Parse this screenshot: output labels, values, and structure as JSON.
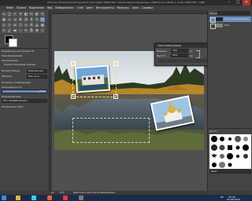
{
  "titlebar": {
    "title": "[Snimok_ekrana] (импортировано)-16.0 (Цвет RGB 8 бит гамма-корректированные, GIMP built-in sRGB, 1 слой) 1366x768 – GIMP",
    "minimize": "–",
    "maximize": "□",
    "close": "✕"
  },
  "menubar": [
    "Файл",
    "Правка",
    "Выделение",
    "Вид",
    "Изображение",
    "Слой",
    "Цвет",
    "Инструменты",
    "Фильтры",
    "Окна",
    "Справка"
  ],
  "tool_options": {
    "title": "Параметры инструментов",
    "transform_label": "Преобразование:",
    "direction_label": "Направление",
    "direction_value": "Корректирующее (назад)",
    "interpolation_label": "Интерполяция",
    "interpolation_value": "Кубическая",
    "clipping_label": "Обрезка",
    "clipping_value": "Как есть",
    "preview_label": "Показать изображение",
    "opacity_label": "Непрозрачность",
    "opacity_value": "100.0",
    "guides_label": "Направляющие",
    "guides_value": "Нет направляющих",
    "constrain_label": "Ограничить (Ctrl)"
  },
  "dialog": {
    "title": "Масштабирование",
    "width_label": "Ширина",
    "width_value": "700",
    "height_label": "Высота",
    "height_value": "524",
    "unit": "px"
  },
  "layers": {
    "mode_label": "Режим",
    "items": [
      {
        "name": "Фото_изображение"
      },
      {
        "name": "Фон"
      }
    ]
  },
  "brushes": {
    "label": "Кисти",
    "preset": "Basic"
  },
  "statusbar": {
    "unit": "px",
    "zoom": "33%",
    "message": "Щёлкните для масштабирования"
  },
  "taskbar": {
    "time": "23:44",
    "date": "04.09.2019",
    "lang": "RU"
  },
  "colors": {
    "bg": "#3c3c3c",
    "panel": "#454545",
    "taskbar": "#1c2b4a",
    "accent": "#6a8bbf"
  }
}
